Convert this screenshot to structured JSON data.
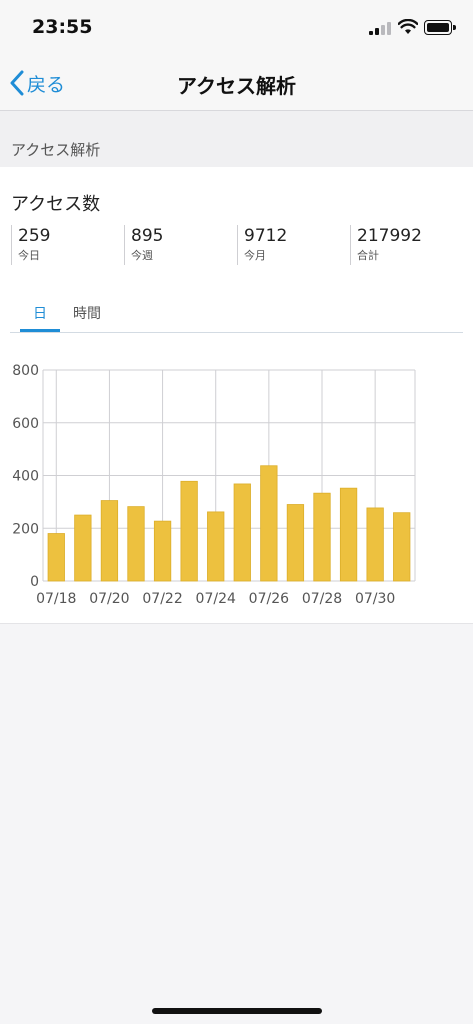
{
  "status_bar": {
    "time": "23:55"
  },
  "nav": {
    "back_label": "戻る",
    "title": "アクセス解析"
  },
  "section": {
    "header": "アクセス解析"
  },
  "access": {
    "title": "アクセス数",
    "stats": [
      {
        "value": "259",
        "label": "今日"
      },
      {
        "value": "895",
        "label": "今週"
      },
      {
        "value": "9712",
        "label": "今月"
      },
      {
        "value": "217992",
        "label": "合計"
      }
    ]
  },
  "tabs": [
    {
      "label": "日"
    },
    {
      "label": "時間"
    }
  ],
  "colors": {
    "accent": "#1f8dd6",
    "bar": "#edc13f",
    "bar_stroke": "#dcae2a",
    "grid": "#cfcfd3"
  },
  "chart_data": {
    "type": "bar",
    "categories": [
      "07/18",
      "07/19",
      "07/20",
      "07/21",
      "07/22",
      "07/23",
      "07/24",
      "07/25",
      "07/26",
      "07/27",
      "07/28",
      "07/29",
      "07/30",
      "07/31"
    ],
    "x_tick_labels": [
      "07/18",
      "07/20",
      "07/22",
      "07/24",
      "07/26",
      "07/28",
      "07/30"
    ],
    "values": [
      180,
      250,
      305,
      282,
      227,
      378,
      262,
      368,
      437,
      290,
      333,
      352,
      277,
      259
    ],
    "y_ticks": [
      0,
      200,
      400,
      600,
      800
    ],
    "ylim": [
      0,
      800
    ],
    "grid": true
  }
}
